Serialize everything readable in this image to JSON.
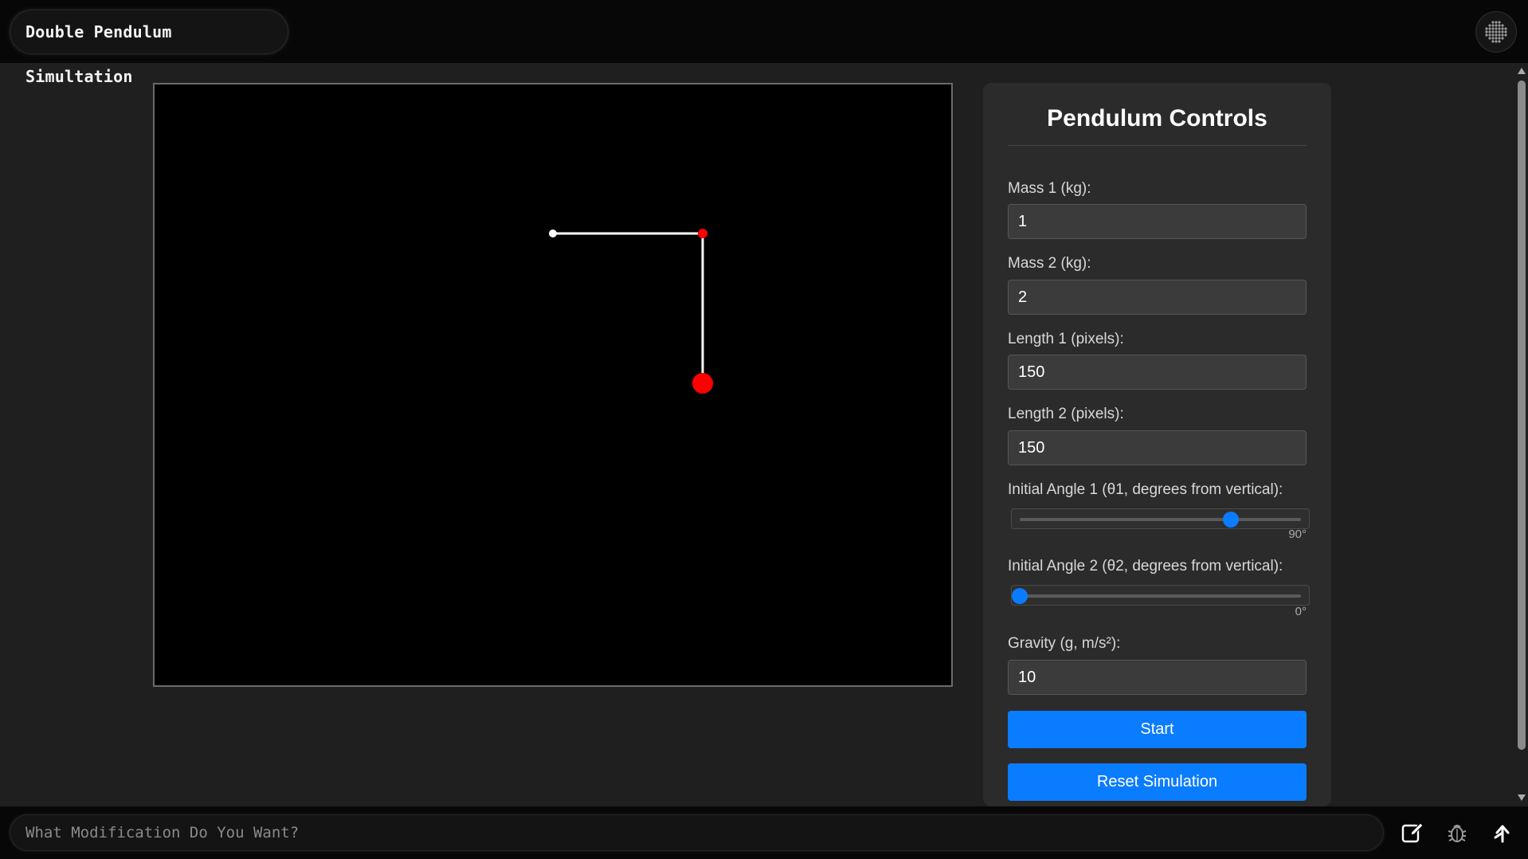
{
  "app": {
    "title": "Double Pendulum Simultation"
  },
  "controls": {
    "heading": "Pendulum Controls",
    "mass1": {
      "label": "Mass 1 (kg):",
      "value": "1"
    },
    "mass2": {
      "label": "Mass 2 (kg):",
      "value": "2"
    },
    "length1": {
      "label": "Length 1 (pixels):",
      "value": "150"
    },
    "length2": {
      "label": "Length 2 (pixels):",
      "value": "150"
    },
    "angle1": {
      "label": "Initial Angle 1 (θ1, degrees from vertical):",
      "value_text": "90°",
      "value": 90,
      "min": -180,
      "max": 180
    },
    "angle2": {
      "label": "Initial Angle 2 (θ2, degrees from vertical):",
      "value_text": "0°",
      "value": 0,
      "min": 0,
      "max": 360
    },
    "gravity": {
      "label": "Gravity (g, m/s²):",
      "value": "10"
    },
    "start_label": "Start",
    "reset_label": "Reset Simulation"
  },
  "bottom": {
    "prompt_placeholder": "What Modification Do You Want?"
  },
  "icons": {
    "menu": "grid-dots-icon",
    "edit": "edit-icon",
    "debug": "bug-icon",
    "submit": "send-arrow-icon"
  },
  "colors": {
    "accent": "#0a7cff",
    "bob": "#ff0000",
    "rod": "#ffffff",
    "canvas_bg": "#000000"
  }
}
